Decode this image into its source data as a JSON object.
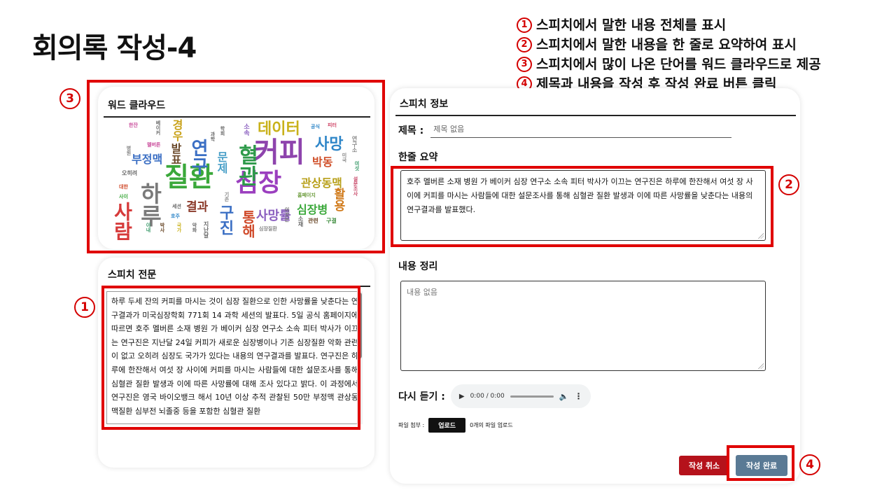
{
  "title": "회의록 작성-4",
  "instructions": [
    {
      "num": "1",
      "text": "스피치에서 말한 내용 전체를 표시"
    },
    {
      "num": "2",
      "text": "스피치에서 말한 내용을 한 줄로 요약하여 표시"
    },
    {
      "num": "3",
      "text": "스피치에서 많이 나온 단어를 워드 클라우드로 제공"
    },
    {
      "num": "4",
      "text": "제목과 내용을 작성 후 작성 완료 버튼 클릭"
    }
  ],
  "markers": {
    "one": "1",
    "two": "2",
    "three": "3",
    "four": "4"
  },
  "word_cloud": {
    "title": "워드 클라우드",
    "words": [
      {
        "text": "심장",
        "color": "#9b3fbf"
      },
      {
        "text": "질환",
        "color": "#3aa83a"
      },
      {
        "text": "커피",
        "color": "#8e44ad"
      },
      {
        "text": "데이터",
        "color": "#c9b11a"
      },
      {
        "text": "사망",
        "color": "#2f86c8"
      },
      {
        "text": "혈관",
        "color": "#2e9a4a"
      },
      {
        "text": "하루",
        "color": "#7a7a7a"
      },
      {
        "text": "사람",
        "color": "#d63a3a"
      },
      {
        "text": "연구",
        "color": "#3b6fc4"
      },
      {
        "text": "발표",
        "color": "#6b4a2b"
      },
      {
        "text": "경우",
        "color": "#c9a21a"
      },
      {
        "text": "부정맥",
        "color": "#3b6fc4"
      },
      {
        "text": "문제",
        "color": "#4aa0c8"
      },
      {
        "text": "박동",
        "color": "#d0502a"
      },
      {
        "text": "관상동맥",
        "color": "#b8a01a"
      },
      {
        "text": "사망률",
        "color": "#8a5fbf"
      },
      {
        "text": "심장병",
        "color": "#3aa83a"
      },
      {
        "text": "결과",
        "color": "#8b3a2a"
      },
      {
        "text": "구진",
        "color": "#3b6fc4"
      },
      {
        "text": "통해",
        "color": "#d04a2a"
      },
      {
        "text": "활용",
        "color": "#d07a1a"
      },
      {
        "text": "연구소",
        "color": "#888"
      },
      {
        "text": "공식",
        "color": "#2f86c8"
      },
      {
        "text": "피터",
        "color": "#d04a6a"
      },
      {
        "text": "여섯",
        "color": "#3a9a6a"
      },
      {
        "text": "홈페이지",
        "color": "#6a9a3a"
      },
      {
        "text": "관련",
        "color": "#6b4a2b"
      },
      {
        "text": "구결",
        "color": "#3a8a3a"
      },
      {
        "text": "심장질환",
        "color": "#888"
      },
      {
        "text": "소속",
        "color": "#8a5fbf"
      },
      {
        "text": "한잔",
        "color": "#c94a9a"
      },
      {
        "text": "베이커",
        "color": "#6a6a6a"
      },
      {
        "text": "멜버른",
        "color": "#c94a9a"
      },
      {
        "text": "오히려",
        "color": "#6a6a6a"
      },
      {
        "text": "대한",
        "color": "#d04a2a"
      },
      {
        "text": "사이",
        "color": "#3aa83a"
      },
      {
        "text": "세션",
        "color": "#6a6a6a"
      },
      {
        "text": "호주",
        "color": "#2f86c8"
      },
      {
        "text": "기존",
        "color": "#888"
      },
      {
        "text": "과학",
        "color": "#6a6a6a"
      },
      {
        "text": "학회",
        "color": "#6a6a6a"
      },
      {
        "text": "병원",
        "color": "#888"
      },
      {
        "text": "이내",
        "color": "#3a9a6a"
      },
      {
        "text": "박사",
        "color": "#6b4a2b"
      },
      {
        "text": "국가",
        "color": "#c9b11a"
      },
      {
        "text": "악화",
        "color": "#6a6a6a"
      },
      {
        "text": "지난달",
        "color": "#6a6a6a"
      },
      {
        "text": "소재",
        "color": "#6a6a6a"
      },
      {
        "text": "이끄는",
        "color": "#6a6a6a"
      },
      {
        "text": "미국",
        "color": "#888"
      },
      {
        "text": "설문조사",
        "color": "#c94a6a"
      }
    ]
  },
  "speech": {
    "title": "스피치 전문",
    "text": "하루 두세 잔의 커피를 마시는 것이 심장 질환으로 인한 사망률을 낮춘다는 연구결과가 미국심장학회 771회 14 과학 세션의 발표다. 5일 공식 홈페이지에 따르면 호주 멜버른 소재 병원 가 베이커 심장 연구소 소속 피터 박사가 이끄는 연구진은 지난달 24일 커피가 새로운 심장병이나 기존 심장질환 악화 관련이 없고 오히려 심장도 국가가 있다는 내용의 연구결과를 발표다. 연구진은 하루에 한잔해서 여섯 장 사이에 커피를 마시는 사람들에 대한 설문조사를 통해 심혈관 질환 발생과 이에 따른 사망률에 대해 조사 있다고 밝다. 이 과정에서 연구진은 영국 바이오뱅크 해서 10년 이상 추적 관찰된 50만 부정맥 관상동맥질환 심부전 뇌졸중 등을 포함한 심혈관 질환"
  },
  "speech_info": {
    "title": "스피치 정보",
    "subject_label": "제목 :",
    "subject_placeholder": "제목 없음",
    "summary_label": "한줄 요약",
    "summary_text": "호주 멜버른 소재 병원 가 베이커 심장 연구소 소속 피터 박사가 이끄는 연구진은 하루에 한잔해서 여섯 장 사이에 커피를 마시는 사람들에 대한 설문조사를 통해 심혈관 질환 발생과 이에 따른 사망률을 낮춘다는 내용의 연구결과를 발표했다.",
    "content_label": "내용 정리",
    "content_placeholder": "내용 없음",
    "listen_label": "다시 듣기 :",
    "audio_time": "0:00 / 0:00",
    "attach_label": "파일 첨부 :",
    "upload_label": "업로드",
    "upload_count": "0개의 파일 업로드",
    "cancel_label": "작성 취소",
    "complete_label": "작성 완료"
  },
  "colors": {
    "highlight": "#e00000",
    "cancel_button": "#b5121b",
    "complete_button": "#5a7a95",
    "upload_button": "#111111"
  }
}
